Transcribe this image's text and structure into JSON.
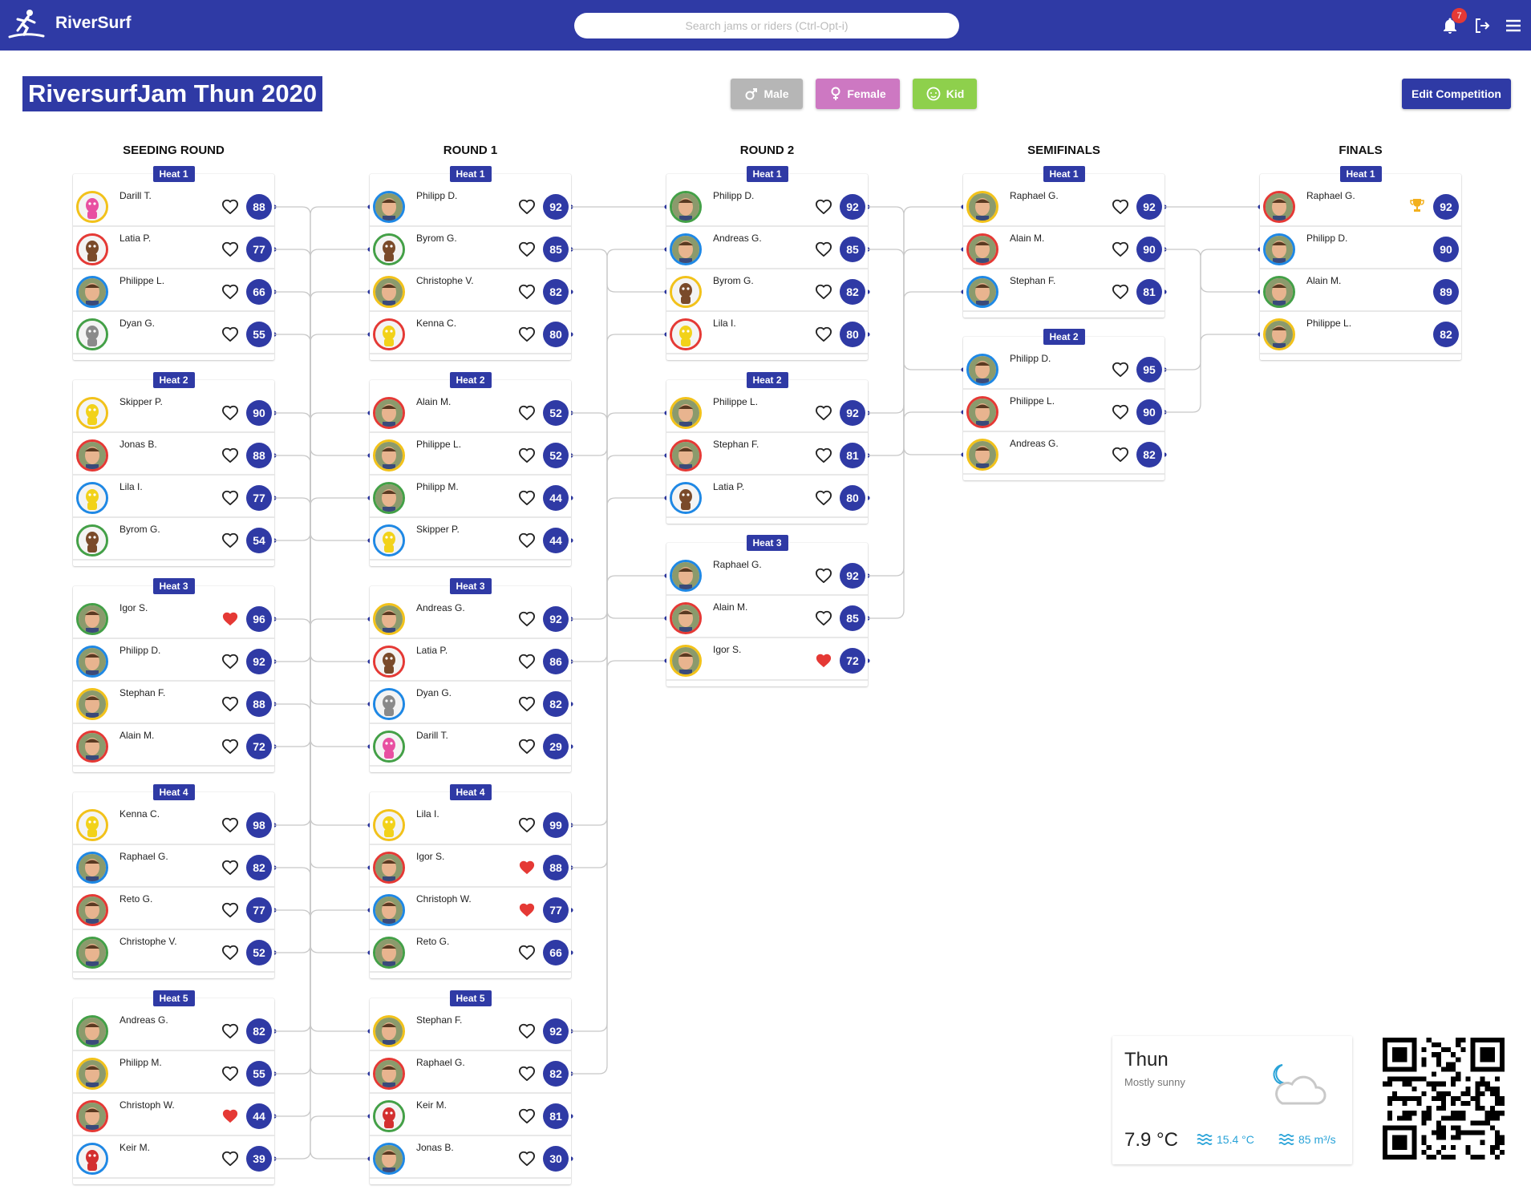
{
  "app": {
    "name": "RiverSurf",
    "search_placeholder": "Search jams or riders (Ctrl-Opt-i)",
    "notification_count": "7"
  },
  "competition": {
    "title": "RiversurfJam Thun 2020",
    "edit_label": "Edit Competition"
  },
  "filters": {
    "male": "Male",
    "female": "Female",
    "kid": "Kid"
  },
  "colors": {
    "primary": "#2f3aa5",
    "male": "#b6b6b6",
    "female": "#cd78c2",
    "kid": "#8ed04c",
    "heart_active": "#e53935",
    "trophy": "#f2b01e"
  },
  "rounds": [
    {
      "title": "SEEDING ROUND",
      "heats": [
        {
          "label": "Heat 1",
          "riders": [
            {
              "name": "Darill T.",
              "score": "88",
              "ring": "#f2c21a",
              "avatar": "pink-toy",
              "liked": false
            },
            {
              "name": "Latia P.",
              "score": "77",
              "ring": "#e53935",
              "avatar": "brown-toy",
              "liked": false
            },
            {
              "name": "Philippe L.",
              "score": "66",
              "ring": "#1e88e5",
              "avatar": "face",
              "liked": false
            },
            {
              "name": "Dyan G.",
              "score": "55",
              "ring": "#43a047",
              "avatar": "grey-toy",
              "liked": false
            }
          ]
        },
        {
          "label": "Heat 2",
          "riders": [
            {
              "name": "Skipper P.",
              "score": "90",
              "ring": "#f2c21a",
              "avatar": "yellow-toy",
              "liked": false
            },
            {
              "name": "Jonas B.",
              "score": "88",
              "ring": "#e53935",
              "avatar": "face",
              "liked": false
            },
            {
              "name": "Lila I.",
              "score": "77",
              "ring": "#1e88e5",
              "avatar": "yellow-toy",
              "liked": false
            },
            {
              "name": "Byrom G.",
              "score": "54",
              "ring": "#43a047",
              "avatar": "brown-toy",
              "liked": false
            }
          ]
        },
        {
          "label": "Heat 3",
          "riders": [
            {
              "name": "Igor S.",
              "score": "96",
              "ring": "#43a047",
              "avatar": "face",
              "liked": true
            },
            {
              "name": "Philipp D.",
              "score": "92",
              "ring": "#1e88e5",
              "avatar": "face",
              "liked": false
            },
            {
              "name": "Stephan F.",
              "score": "88",
              "ring": "#f2c21a",
              "avatar": "face",
              "liked": false
            },
            {
              "name": "Alain M.",
              "score": "72",
              "ring": "#e53935",
              "avatar": "face",
              "liked": false
            }
          ]
        },
        {
          "label": "Heat 4",
          "riders": [
            {
              "name": "Kenna C.",
              "score": "98",
              "ring": "#f2c21a",
              "avatar": "yellow-toy",
              "liked": false
            },
            {
              "name": "Raphael G.",
              "score": "82",
              "ring": "#1e88e5",
              "avatar": "face",
              "liked": false
            },
            {
              "name": "Reto G.",
              "score": "77",
              "ring": "#e53935",
              "avatar": "face",
              "liked": false
            },
            {
              "name": "Christophe V.",
              "score": "52",
              "ring": "#43a047",
              "avatar": "face",
              "liked": false
            }
          ]
        },
        {
          "label": "Heat 5",
          "riders": [
            {
              "name": "Andreas G.",
              "score": "82",
              "ring": "#43a047",
              "avatar": "face",
              "liked": false
            },
            {
              "name": "Philipp M.",
              "score": "55",
              "ring": "#f2c21a",
              "avatar": "face",
              "liked": false
            },
            {
              "name": "Christoph W.",
              "score": "44",
              "ring": "#e53935",
              "avatar": "face",
              "liked": true
            },
            {
              "name": "Keir M.",
              "score": "39",
              "ring": "#1e88e5",
              "avatar": "red-toy",
              "liked": false
            }
          ]
        }
      ]
    },
    {
      "title": "ROUND 1",
      "heats": [
        {
          "label": "Heat 1",
          "riders": [
            {
              "name": "Philipp D.",
              "score": "92",
              "ring": "#1e88e5",
              "avatar": "face",
              "liked": false
            },
            {
              "name": "Byrom G.",
              "score": "85",
              "ring": "#43a047",
              "avatar": "brown-toy",
              "liked": false
            },
            {
              "name": "Christophe V.",
              "score": "82",
              "ring": "#f2c21a",
              "avatar": "face",
              "liked": false
            },
            {
              "name": "Kenna C.",
              "score": "80",
              "ring": "#e53935",
              "avatar": "yellow-toy",
              "liked": false
            }
          ]
        },
        {
          "label": "Heat 2",
          "riders": [
            {
              "name": "Alain M.",
              "score": "52",
              "ring": "#e53935",
              "avatar": "face",
              "liked": false
            },
            {
              "name": "Philippe L.",
              "score": "52",
              "ring": "#f2c21a",
              "avatar": "face",
              "liked": false
            },
            {
              "name": "Philipp M.",
              "score": "44",
              "ring": "#43a047",
              "avatar": "face",
              "liked": false
            },
            {
              "name": "Skipper P.",
              "score": "44",
              "ring": "#1e88e5",
              "avatar": "yellow-toy",
              "liked": false
            }
          ]
        },
        {
          "label": "Heat 3",
          "riders": [
            {
              "name": "Andreas G.",
              "score": "92",
              "ring": "#f2c21a",
              "avatar": "face",
              "liked": false
            },
            {
              "name": "Latia P.",
              "score": "86",
              "ring": "#e53935",
              "avatar": "brown-toy",
              "liked": false
            },
            {
              "name": "Dyan G.",
              "score": "82",
              "ring": "#1e88e5",
              "avatar": "grey-toy",
              "liked": false
            },
            {
              "name": "Darill T.",
              "score": "29",
              "ring": "#43a047",
              "avatar": "pink-toy",
              "liked": false
            }
          ]
        },
        {
          "label": "Heat 4",
          "riders": [
            {
              "name": "Lila I.",
              "score": "99",
              "ring": "#f2c21a",
              "avatar": "yellow-toy",
              "liked": false
            },
            {
              "name": "Igor S.",
              "score": "88",
              "ring": "#e53935",
              "avatar": "face",
              "liked": true
            },
            {
              "name": "Christoph W.",
              "score": "77",
              "ring": "#1e88e5",
              "avatar": "face",
              "liked": true
            },
            {
              "name": "Reto G.",
              "score": "66",
              "ring": "#43a047",
              "avatar": "face",
              "liked": false
            }
          ]
        },
        {
          "label": "Heat 5",
          "riders": [
            {
              "name": "Stephan F.",
              "score": "92",
              "ring": "#f2c21a",
              "avatar": "face",
              "liked": false
            },
            {
              "name": "Raphael G.",
              "score": "82",
              "ring": "#e53935",
              "avatar": "face",
              "liked": false
            },
            {
              "name": "Keir M.",
              "score": "81",
              "ring": "#43a047",
              "avatar": "red-toy",
              "liked": false
            },
            {
              "name": "Jonas B.",
              "score": "30",
              "ring": "#1e88e5",
              "avatar": "face",
              "liked": false
            }
          ]
        }
      ]
    },
    {
      "title": "ROUND 2",
      "heats": [
        {
          "label": "Heat 1",
          "riders": [
            {
              "name": "Philipp D.",
              "score": "92",
              "ring": "#43a047",
              "avatar": "face",
              "liked": false
            },
            {
              "name": "Andreas G.",
              "score": "85",
              "ring": "#1e88e5",
              "avatar": "face",
              "liked": false
            },
            {
              "name": "Byrom G.",
              "score": "82",
              "ring": "#f2c21a",
              "avatar": "brown-toy",
              "liked": false
            },
            {
              "name": "Lila I.",
              "score": "80",
              "ring": "#e53935",
              "avatar": "yellow-toy",
              "liked": false
            }
          ]
        },
        {
          "label": "Heat 2",
          "riders": [
            {
              "name": "Philippe L.",
              "score": "92",
              "ring": "#f2c21a",
              "avatar": "face",
              "liked": false
            },
            {
              "name": "Stephan F.",
              "score": "81",
              "ring": "#e53935",
              "avatar": "face",
              "liked": false
            },
            {
              "name": "Latia P.",
              "score": "80",
              "ring": "#1e88e5",
              "avatar": "brown-toy",
              "liked": false
            }
          ]
        },
        {
          "label": "Heat 3",
          "riders": [
            {
              "name": "Raphael G.",
              "score": "92",
              "ring": "#1e88e5",
              "avatar": "face",
              "liked": false
            },
            {
              "name": "Alain M.",
              "score": "85",
              "ring": "#e53935",
              "avatar": "face",
              "liked": false
            },
            {
              "name": "Igor S.",
              "score": "72",
              "ring": "#f2c21a",
              "avatar": "face",
              "liked": true
            }
          ]
        }
      ]
    },
    {
      "title": "SEMIFINALS",
      "heats": [
        {
          "label": "Heat 1",
          "riders": [
            {
              "name": "Raphael G.",
              "score": "92",
              "ring": "#f2c21a",
              "avatar": "face",
              "liked": false
            },
            {
              "name": "Alain M.",
              "score": "90",
              "ring": "#e53935",
              "avatar": "face",
              "liked": false
            },
            {
              "name": "Stephan F.",
              "score": "81",
              "ring": "#1e88e5",
              "avatar": "face",
              "liked": false
            }
          ]
        },
        {
          "label": "Heat 2",
          "riders": [
            {
              "name": "Philipp D.",
              "score": "95",
              "ring": "#1e88e5",
              "avatar": "face",
              "liked": false
            },
            {
              "name": "Philippe L.",
              "score": "90",
              "ring": "#e53935",
              "avatar": "face",
              "liked": false
            },
            {
              "name": "Andreas G.",
              "score": "82",
              "ring": "#f2c21a",
              "avatar": "face",
              "liked": false
            }
          ]
        }
      ]
    },
    {
      "title": "FINALS",
      "heats": [
        {
          "label": "Heat 1",
          "riders": [
            {
              "name": "Raphael G.",
              "score": "92",
              "ring": "#e53935",
              "avatar": "face",
              "liked": false,
              "winner": true
            },
            {
              "name": "Philipp D.",
              "score": "90",
              "ring": "#1e88e5",
              "avatar": "face",
              "liked": false,
              "winner": false
            },
            {
              "name": "Alain M.",
              "score": "89",
              "ring": "#43a047",
              "avatar": "face",
              "liked": false,
              "winner": false
            },
            {
              "name": "Philippe L.",
              "score": "82",
              "ring": "#f2c21a",
              "avatar": "face",
              "liked": false,
              "winner": false
            }
          ]
        }
      ]
    }
  ],
  "weather": {
    "city": "Thun",
    "condition": "Mostly sunny",
    "temperature": "7.9 °C",
    "water_temp": "15.4 °C",
    "flow": "85 m³/s",
    "accent": "#29a3d8"
  }
}
